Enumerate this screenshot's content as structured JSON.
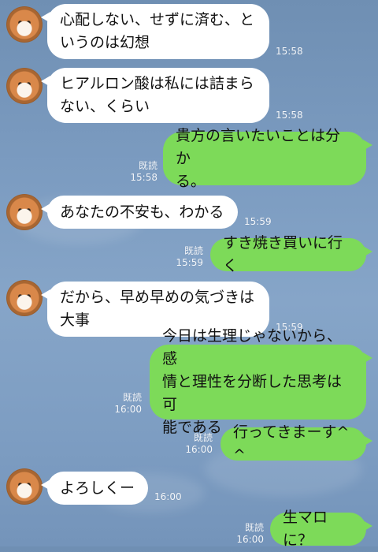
{
  "messages": [
    {
      "side": "in",
      "lines": [
        "心配しない、せずに済む、と",
        "いうのは幻想"
      ],
      "time": "15:58"
    },
    {
      "side": "in",
      "lines": [
        "ヒアルロン酸は私には詰まら",
        "ない、くらい"
      ],
      "time": "15:58"
    },
    {
      "side": "out",
      "lines": [
        "貴方の言いたいことは分か",
        "る。"
      ],
      "read": "既読",
      "time": "15:58"
    },
    {
      "side": "in",
      "lines": [
        "あなたの不安も、わかる"
      ],
      "time": "15:59"
    },
    {
      "side": "out",
      "lines": [
        "すき焼き買いに行く"
      ],
      "read": "既読",
      "time": "15:59"
    },
    {
      "side": "in",
      "lines": [
        "だから、早め早めの気づきは",
        "大事"
      ],
      "time": "15:59"
    },
    {
      "side": "out",
      "lines": [
        "今日は生理じゃないから、感",
        "情と理性を分断した思考は可",
        "能である"
      ],
      "read": "既読",
      "time": "16:00"
    },
    {
      "side": "out",
      "lines": [
        "行ってきまーす^ ^"
      ],
      "read": "既読",
      "time": "16:00"
    },
    {
      "side": "in",
      "lines": [
        "よろしくー"
      ],
      "time": "16:00"
    },
    {
      "side": "out",
      "lines": [
        "生マロに？"
      ],
      "read": "既読",
      "time": "16:00"
    }
  ]
}
